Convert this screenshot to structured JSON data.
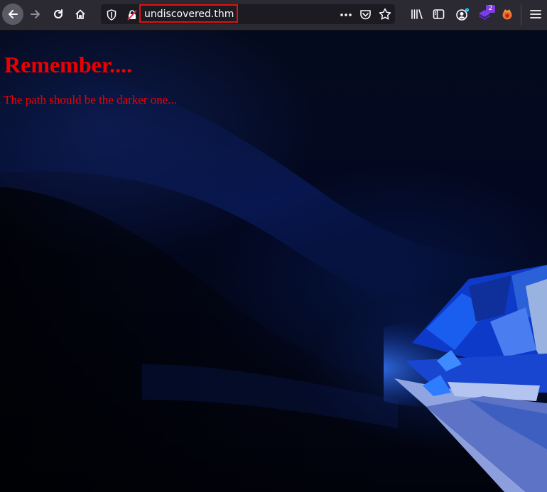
{
  "browser": {
    "url": "undiscovered.thm",
    "extension_badge": "2",
    "icons": [
      "back-arrow-icon",
      "forward-arrow-icon",
      "reload-icon",
      "home-icon",
      "tracking-shield-icon",
      "insecure-lock-icon",
      "more-actions-icon",
      "pocket-icon",
      "bookmark-star-icon",
      "library-icon",
      "sidebar-icon",
      "account-icon",
      "extension-icon",
      "extension-fox-icon",
      "menu-icon"
    ]
  },
  "page": {
    "heading": "Remember....",
    "text": "The path should be the darker one...",
    "text_color": "#ee0000",
    "background_color": "#01030b"
  }
}
